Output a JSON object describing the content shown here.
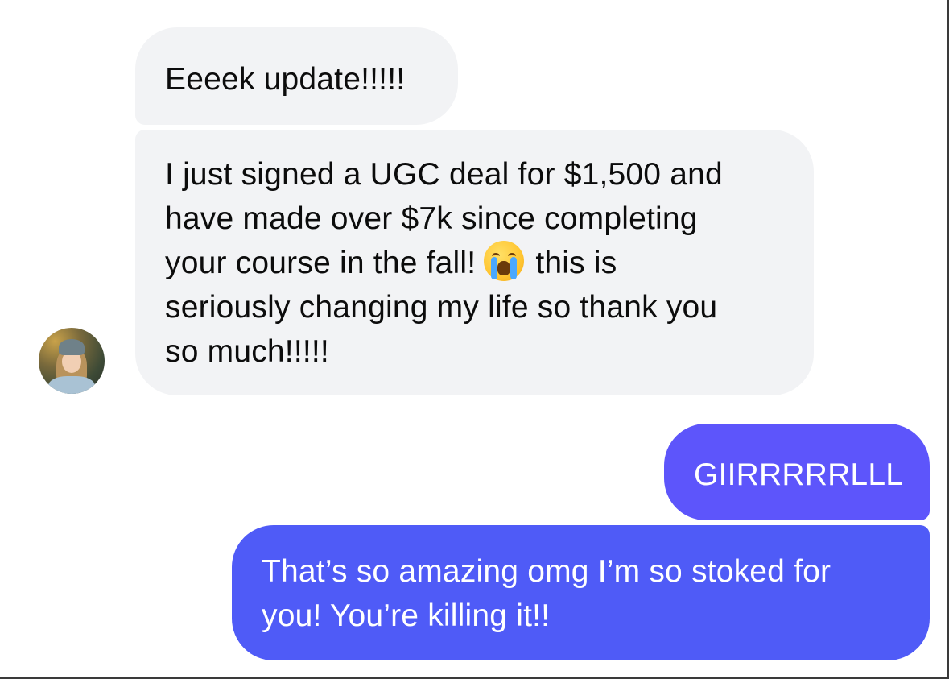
{
  "conversation": {
    "messages": [
      {
        "sender": "contact",
        "lines": [
          "Eeeek update!!!!!"
        ]
      },
      {
        "sender": "contact",
        "lines": [
          "I just signed a UGC deal for $1,500 and",
          "have made over $7k since completing",
          "your course in the fall!",
          "this is",
          "seriously changing my life so thank you",
          "so much!!!!!"
        ],
        "emoji": "loudly-crying-face-icon"
      },
      {
        "sender": "me",
        "lines": [
          "GIIRRRRRLLL"
        ]
      },
      {
        "sender": "me",
        "lines": [
          "That’s so amazing omg I’m so stoked for",
          "you! You’re killing it!!"
        ]
      }
    ]
  },
  "colors": {
    "incoming_bubble": "#f2f3f5",
    "incoming_text": "#0c0c0c",
    "outgoing_bubble_1": "#5d55fb",
    "outgoing_bubble_2": "#4f5bf7",
    "outgoing_text": "#ffffff"
  }
}
